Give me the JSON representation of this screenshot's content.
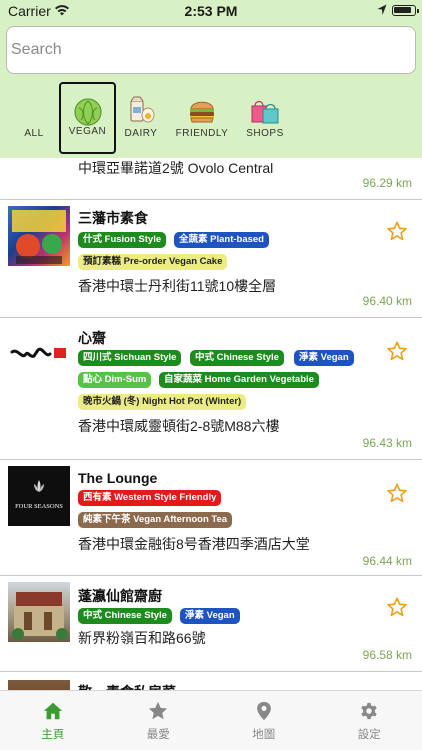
{
  "status_bar": {
    "carrier": "Carrier",
    "time": "2:53 PM"
  },
  "search": {
    "placeholder": "Search",
    "value": ""
  },
  "filters": [
    {
      "label": "ALL",
      "icon": "none",
      "selected": false
    },
    {
      "label": "VEGAN",
      "icon": "cabbage-icon",
      "selected": true
    },
    {
      "label": "DAIRY",
      "icon": "milk-egg-icon",
      "selected": false
    },
    {
      "label": "FRIENDLY",
      "icon": "burger-icon",
      "selected": false
    },
    {
      "label": "SHOPS",
      "icon": "shopping-bags-icon",
      "selected": false
    }
  ],
  "restaurants": [
    {
      "name": "",
      "address": "中環亞畢諾道2號 Ovolo Central",
      "distance": "96.29 km",
      "tags": []
    },
    {
      "name": "三藩市素食",
      "address": "香港中環士丹利街11號10樓全層",
      "distance": "96.40 km",
      "tags": [
        "什式 Fusion Style",
        "全蔬素 Plant-based",
        "預訂素糕 Pre-order Vegan Cake"
      ]
    },
    {
      "name": "心齋",
      "address": "香港中環威靈頓街2-8號M88六樓",
      "distance": "96.43 km",
      "tags": [
        "四川式 Sichuan Style",
        "中式 Chinese Style",
        "淨素 Vegan",
        "點心 Dim-Sum",
        "自家蔬菜 Home Garden Vegetable",
        "晚市火鍋 (冬) Night Hot Pot (Winter)"
      ]
    },
    {
      "name": "The Lounge",
      "address": "香港中環金融街8号香港四季酒店大堂",
      "distance": "96.44 km",
      "tags": [
        "西有素 Western Style Friendly",
        "純素下午茶 Vegan Afternoon Tea"
      ],
      "thumb_text": "FOUR SEASONS"
    },
    {
      "name": "蓬瀛仙館齋廚",
      "address": "新界粉嶺百和路66號",
      "distance": "96.58 km",
      "tags": [
        "中式 Chinese Style",
        "淨素 Vegan"
      ]
    },
    {
      "name": "敬一素食私房菜",
      "address": "",
      "distance": "",
      "tags": []
    }
  ],
  "tabs": [
    {
      "label": "主頁",
      "icon": "home-icon",
      "active": true
    },
    {
      "label": "最愛",
      "icon": "star-icon",
      "active": false
    },
    {
      "label": "地圖",
      "icon": "map-pin-icon",
      "active": false
    },
    {
      "label": "設定",
      "icon": "gear-icon",
      "active": false
    }
  ],
  "colors": {
    "header_bg": "#d8f1c4",
    "accent_green": "#3c9c32",
    "distance_green": "#7aa555",
    "star_orange": "#f0a020",
    "tag_green": "#1e8b1e",
    "tag_blue": "#1e54c2",
    "tag_yellow": "#ecec86",
    "tag_light_green": "#57c24a",
    "tag_red": "#e41a1a",
    "tag_brown": "#8c6a4d"
  }
}
